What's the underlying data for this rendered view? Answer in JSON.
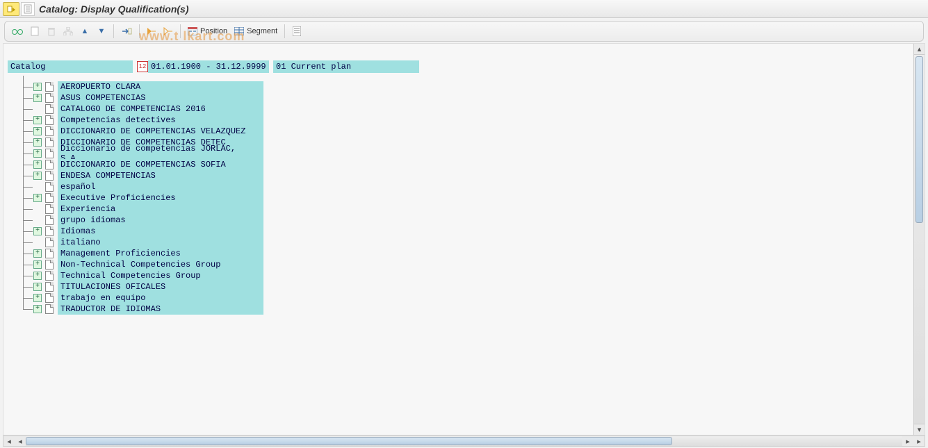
{
  "title": "Catalog: Display Qualification(s)",
  "watermark": "www.t     lkart.com",
  "toolbar": {
    "position_label": "Position",
    "segment_label": "Segment"
  },
  "header": {
    "root": "Catalog",
    "date_range": "01.01.1900 - 31.12.9999",
    "plan": "01 Current plan"
  },
  "tree": [
    {
      "label": "AEROPUERTO CLARA",
      "expandable": true
    },
    {
      "label": "ASUS COMPETENCIAS",
      "expandable": true
    },
    {
      "label": "CATALOGO DE COMPETENCIAS 2016",
      "expandable": false
    },
    {
      "label": "Competencias detectives",
      "expandable": true
    },
    {
      "label": "DICCIONARIO  DE COMPETENCIAS VELAZQUEZ",
      "expandable": true
    },
    {
      "label": "DICCIONARIO DE COMPETENCIAS DETEC",
      "expandable": true
    },
    {
      "label": "Diccionario de competencias JORLAC, S.A.",
      "expandable": true
    },
    {
      "label": "DICCIONARIO DE COMPETENCIAS SOFIA",
      "expandable": true
    },
    {
      "label": "ENDESA COMPETENCIAS",
      "expandable": true
    },
    {
      "label": "español",
      "expandable": false
    },
    {
      "label": "Executive Proficiencies",
      "expandable": true
    },
    {
      "label": "Experiencia",
      "expandable": false
    },
    {
      "label": "grupo idiomas",
      "expandable": false
    },
    {
      "label": "Idiomas",
      "expandable": true
    },
    {
      "label": "italiano",
      "expandable": false
    },
    {
      "label": "Management Proficiencies",
      "expandable": true
    },
    {
      "label": "Non-Technical Competencies Group",
      "expandable": true
    },
    {
      "label": "Technical Competencies Group",
      "expandable": true
    },
    {
      "label": "TITULACIONES OFICALES",
      "expandable": true
    },
    {
      "label": "trabajo en equipo",
      "expandable": true
    },
    {
      "label": "TRADUCTOR DE IDIOMAS",
      "expandable": true
    }
  ]
}
